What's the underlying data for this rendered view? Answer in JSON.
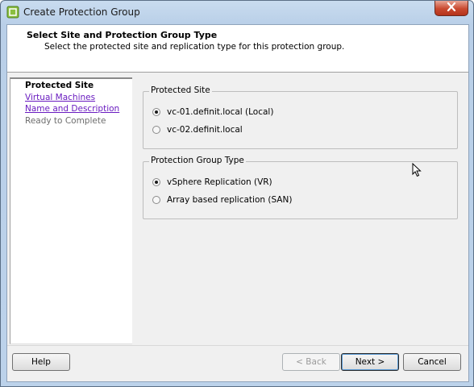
{
  "window": {
    "title": "Create Protection Group"
  },
  "header": {
    "title": "Select Site and Protection Group Type",
    "subtitle": "Select the protected site and replication type for this protection group."
  },
  "steps": [
    {
      "label": "Protected Site",
      "state": "current"
    },
    {
      "label": "Virtual Machines",
      "state": "link"
    },
    {
      "label": "Name and Description",
      "state": "link"
    },
    {
      "label": "Ready to Complete",
      "state": "pending"
    }
  ],
  "protected_site": {
    "legend": "Protected Site",
    "options": [
      {
        "label": "vc-01.definit.local (Local)",
        "checked": true
      },
      {
        "label": "vc-02.definit.local",
        "checked": false
      }
    ]
  },
  "group_type": {
    "legend": "Protection Group Type",
    "options": [
      {
        "label": "vSphere Replication (VR)",
        "checked": true
      },
      {
        "label": "Array based replication (SAN)",
        "checked": false
      }
    ]
  },
  "buttons": {
    "help": "Help",
    "back": "< Back",
    "next": "Next >",
    "cancel": "Cancel"
  },
  "icons": {
    "app": "vsphere-app-icon",
    "close": "close-icon",
    "cursor": "mouse-pointer-icon"
  },
  "colors": {
    "link": "#6a1cc0",
    "close_button": "#c9492f"
  }
}
